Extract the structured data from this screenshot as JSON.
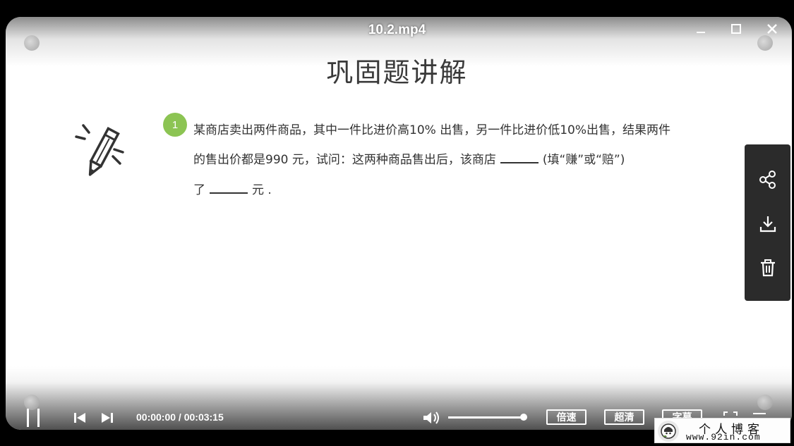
{
  "window": {
    "title": "10.2.mp4"
  },
  "slide": {
    "title": "巩固题讲解",
    "question_number": "1",
    "lines": [
      "某商店卖出两件商品，其中一件比进价高10% 出售，另一件比进价低10%出售，结果两件",
      "的售出价都是990 元，试问：这两种商品售出后，该商店",
      "(填“赚”或“赔”)",
      "了",
      "元 ."
    ]
  },
  "side_panel": {
    "icons": [
      "share-icon",
      "download-icon",
      "trash-icon"
    ]
  },
  "controls": {
    "time_display": "00:00:00 / 00:03:15",
    "speed_label": "倍速",
    "quality_label": "超清",
    "subtitle_label": "字幕",
    "volume_level": 1.0
  },
  "watermark": {
    "title": "个人博客",
    "url": "www.92in.com"
  }
}
